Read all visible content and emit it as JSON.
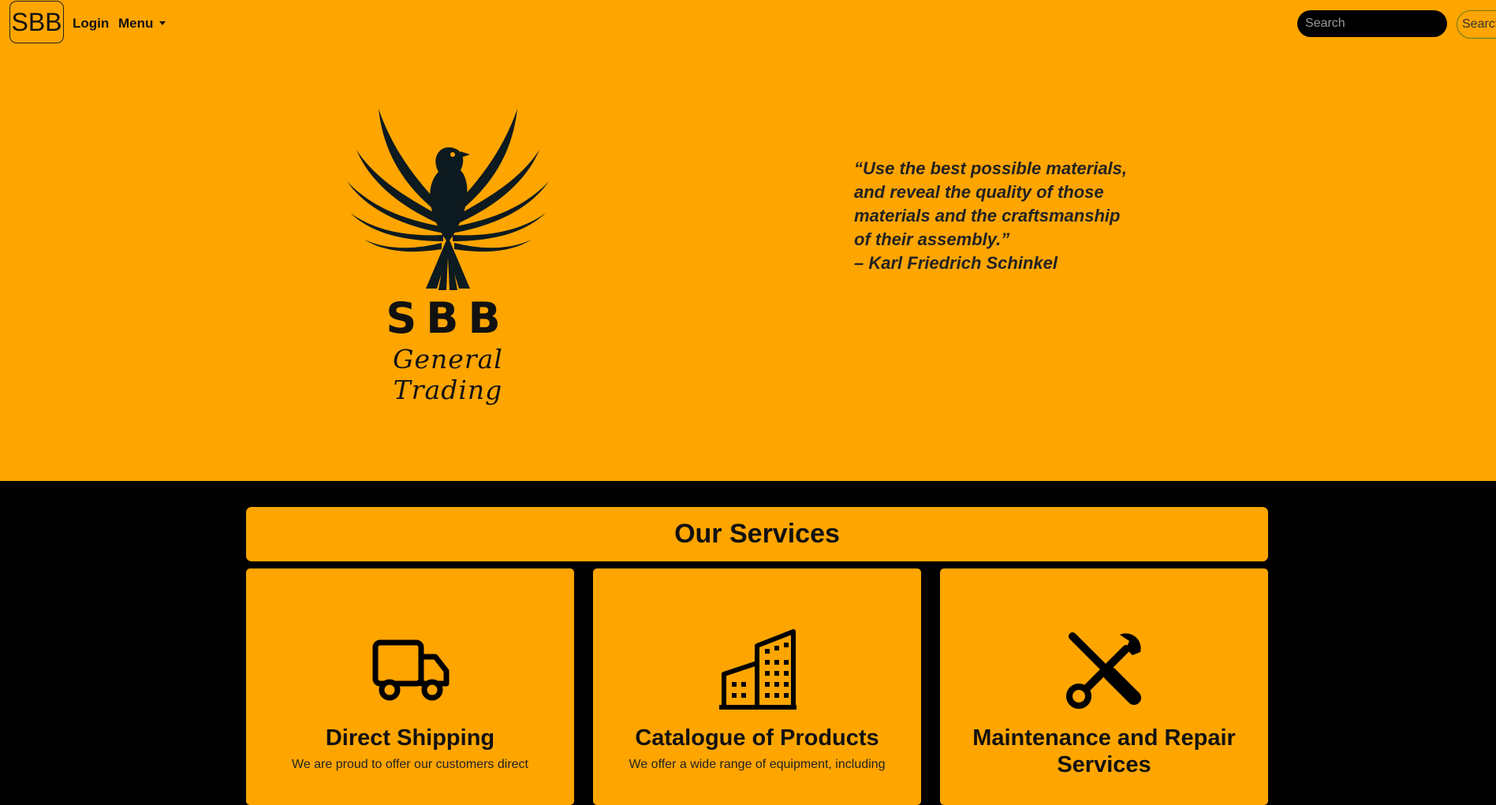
{
  "nav": {
    "brand": "SBB",
    "login": "Login",
    "menu": "Menu",
    "search_placeholder": "Search",
    "search_button": "Search"
  },
  "hero": {
    "logo_title": "SBB",
    "logo_subtitle": "General Trading",
    "quote_lines": [
      "“Use the best possible materials,",
      "and reveal the quality of those",
      "materials and the craftsmanship",
      "of their assembly.”",
      "– Karl Friedrich Schinkel"
    ]
  },
  "services": {
    "heading": "Our Services",
    "cards": [
      {
        "icon": "truck-icon",
        "title": "Direct Shipping",
        "text": "We are proud to offer our customers direct"
      },
      {
        "icon": "building-icon",
        "title": "Catalogue of Products",
        "text": "We offer a wide range of equipment, including"
      },
      {
        "icon": "tools-icon",
        "title": "Maintenance and Repair Services",
        "text": ""
      }
    ]
  },
  "colors": {
    "accent": "#ffa500",
    "dark": "#000000",
    "text": "#111111"
  }
}
